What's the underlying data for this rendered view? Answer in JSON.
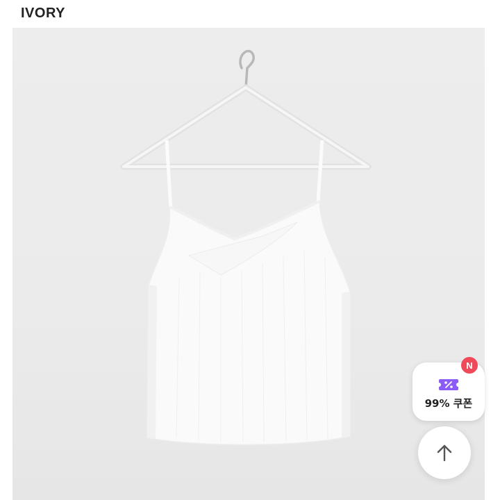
{
  "product": {
    "color_label": "IVORY"
  },
  "coupon": {
    "label": "99% 쿠폰",
    "badge": "N",
    "icon": "coupon-ticket-icon",
    "accent_color": "#8b5cf6",
    "badge_color": "#ef4a5a"
  },
  "scroll_top": {
    "icon": "arrow-up-icon"
  }
}
